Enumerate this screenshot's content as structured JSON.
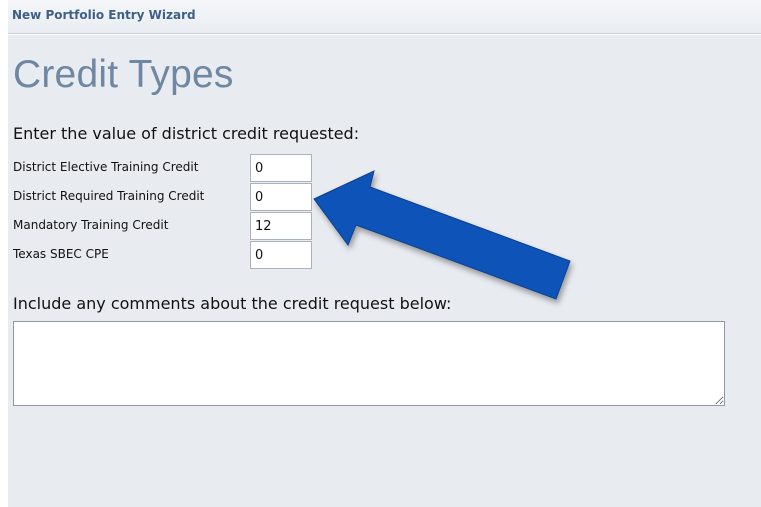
{
  "wizard": {
    "title": "New Portfolio Entry Wizard"
  },
  "page": {
    "heading": "Credit Types",
    "instruction": "Enter the value of district credit requested:"
  },
  "credits": [
    {
      "label": "District Elective Training Credit",
      "value": "0"
    },
    {
      "label": "District Required Training Credit",
      "value": "0"
    },
    {
      "label": "Mandatory Training Credit",
      "value": "12"
    },
    {
      "label": "Texas SBEC CPE",
      "value": "0"
    }
  ],
  "comments": {
    "label": "Include any comments about the credit request below:",
    "value": ""
  },
  "annotation": {
    "arrow_color": "#0a52b8",
    "arrow_icon": "arrow-pointing-up-left-icon"
  },
  "colors": {
    "header_text": "#3e5f86",
    "heading_text": "#6f87a3",
    "panel_background": "#e8ebf0"
  }
}
